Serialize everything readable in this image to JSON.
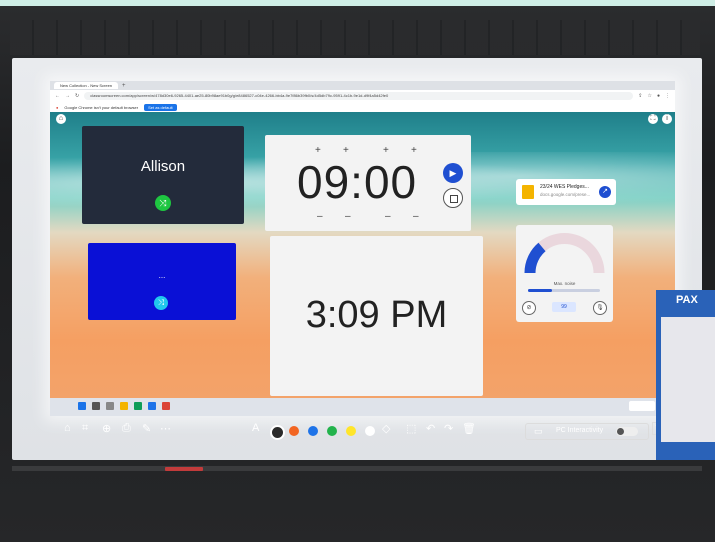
{
  "browser": {
    "tab_title": "New Collection - New Screen",
    "url": "classroomscreen.com/app/screen/w/478d30e6-9265-4401-ae25-80b98ae91b0g/g/e8486527-c04e-4266-bb4a-9e7f86b39fb0/s/4d5db79c-9591-4c1b-9e1d-d9f4a5d42fe0",
    "default_browser_msg": "Google Chrome isn't your default browser",
    "set_default_label": "Set as default"
  },
  "widgets": {
    "name_card": {
      "name": "Allison"
    },
    "blue_card": {
      "text": "..."
    },
    "timer": {
      "display": "09:00"
    },
    "clock": {
      "time": "3:09 PM"
    },
    "doc_link": {
      "title": "23/24 WES Pledges...",
      "source": "docs.google.com/prese..."
    },
    "noise": {
      "label": "Max. noise",
      "count": "99",
      "level": 0.33
    }
  },
  "toolbar": {
    "text_tool": "A",
    "pc_interactivity_label": "PC Interactivity",
    "colors": [
      "#2b2b2b",
      "#f26522",
      "#1e73e8",
      "#22b34c",
      "#ffe52a",
      "#ffffff"
    ]
  },
  "room": {
    "poster_title": "PAX"
  }
}
